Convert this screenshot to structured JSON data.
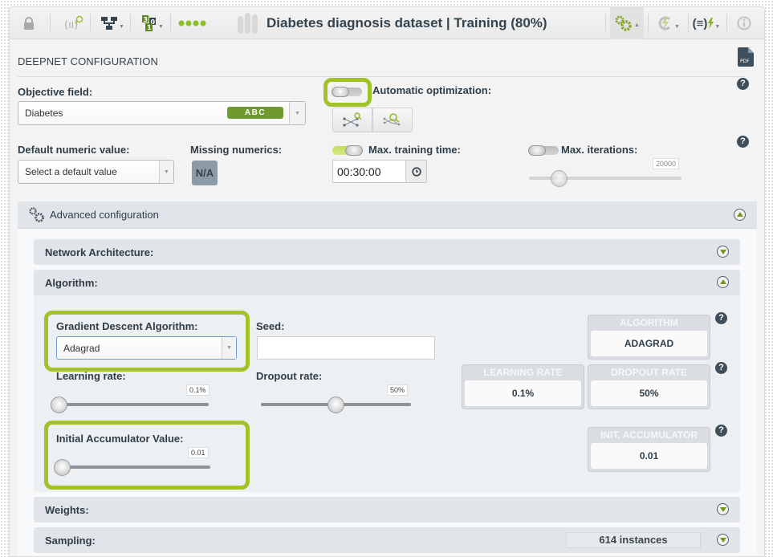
{
  "toolbar": {
    "title": "Diabetes diagnosis dataset | Training (80%)",
    "icons": [
      "lock-icon",
      "sample-search-icon",
      "model-tree-icon",
      "dataset-count-icon",
      "progress-dots-icon",
      "bars-icon",
      "configure-gears-icon",
      "one-click-icon",
      "formula-icon",
      "info-icon"
    ],
    "accent": "#8dbd26"
  },
  "config": {
    "heading": "DEEPNET CONFIGURATION",
    "objective_label": "Objective field:",
    "objective_value": "Diabetes",
    "objective_type": "ABC",
    "auto_opt_label": "Automatic optimization:",
    "auto_opt_enabled": false,
    "default_numeric_label": "Default numeric value:",
    "default_numeric_placeholder": "Select a default value",
    "missing_label": "Missing numerics:",
    "missing_value": "N/A",
    "max_time_label": "Max. training time:",
    "max_time_enabled": true,
    "max_time_value": "00:30:00",
    "max_iter_label": "Max. iterations:",
    "max_iter_enabled": false,
    "max_iter_value": "20000"
  },
  "advanced": {
    "title": "Advanced configuration",
    "sections": {
      "network": "Network Architecture:",
      "algorithm": "Algorithm:",
      "weights": "Weights:",
      "sampling": "Sampling:"
    },
    "sampling_count": "614 instances",
    "algorithm": {
      "gd_label": "Gradient Descent Algorithm:",
      "gd_value": "Adagrad",
      "seed_label": "Seed:",
      "seed_value": "",
      "lr_label": "Learning rate:",
      "lr_value": "0.1%",
      "dropout_label": "Dropout rate:",
      "dropout_value": "50%",
      "dropout_fraction": 0.5,
      "init_acc_label": "Initial Accumulator Value:",
      "init_acc_value": "0.01"
    },
    "summary": {
      "algorithm_title": "ALGORITHM",
      "algorithm_value": "ADAGRAD",
      "lr_title": "LEARNING RATE",
      "lr_value": "0.1%",
      "dropout_title": "DROPOUT RATE",
      "dropout_value": "50%",
      "init_acc_title": "INIT. ACCUMULATOR",
      "init_acc_value": "0.01"
    }
  }
}
